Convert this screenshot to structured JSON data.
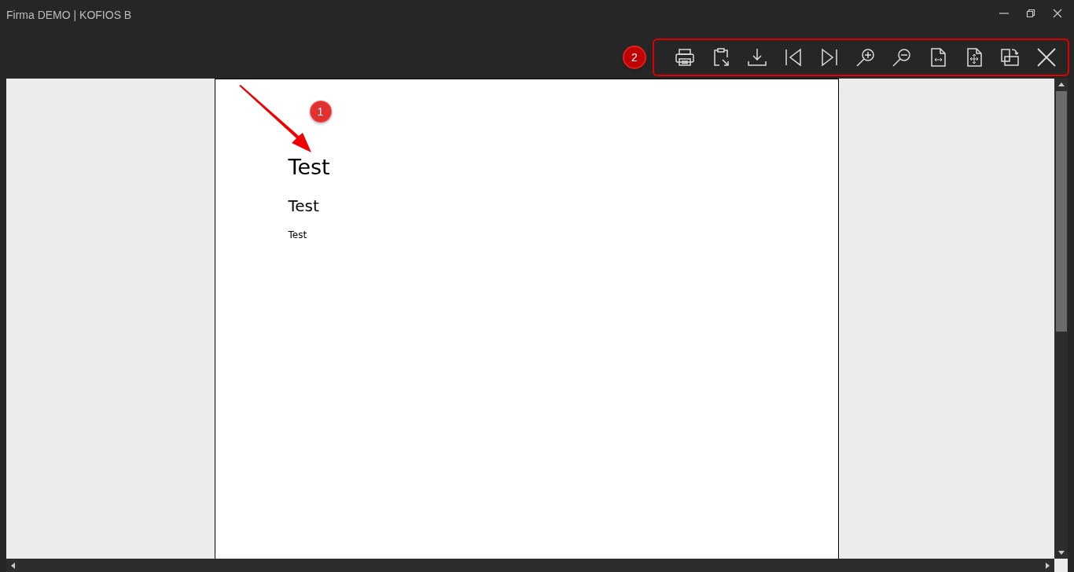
{
  "window": {
    "title": "Firma DEMO | KOFIOS B"
  },
  "annotations": [
    {
      "label": "1",
      "kind": "pointer"
    },
    {
      "label": "2",
      "kind": "frame"
    }
  ],
  "toolbar": {
    "buttons": [
      {
        "kind": "print"
      },
      {
        "kind": "export"
      },
      {
        "kind": "download"
      },
      {
        "kind": "first"
      },
      {
        "kind": "last"
      },
      {
        "kind": "zoomin"
      },
      {
        "kind": "zoomout"
      },
      {
        "kind": "fitwidth"
      },
      {
        "kind": "fitpage"
      },
      {
        "kind": "rotate"
      },
      {
        "kind": "close"
      }
    ]
  },
  "document": {
    "lines": [
      {
        "text": "Test",
        "kind": "h1"
      },
      {
        "text": "Test",
        "kind": "h2"
      },
      {
        "text": "Test",
        "kind": "body"
      }
    ]
  }
}
